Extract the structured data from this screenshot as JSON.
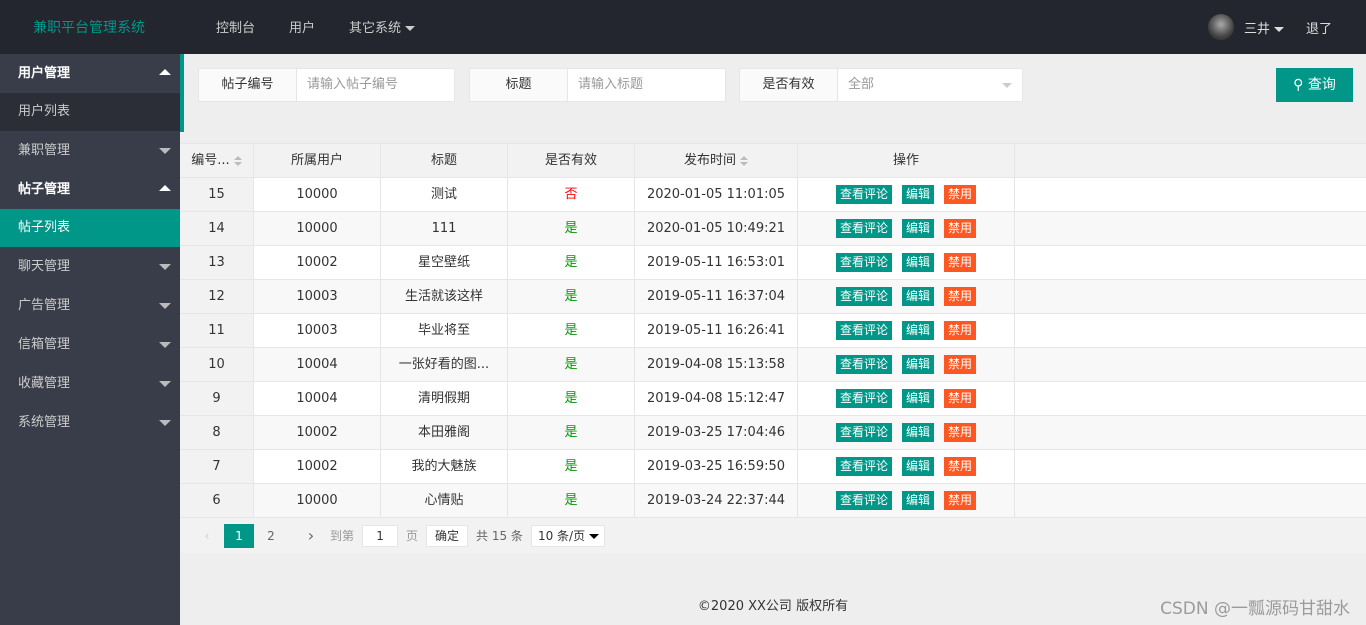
{
  "header": {
    "logo": "兼职平台管理系统",
    "nav": [
      "控制台",
      "用户",
      "其它系统"
    ],
    "user": "三井",
    "logout": "退了"
  },
  "sidebar": [
    {
      "label": "用户管理",
      "open": true,
      "children": [
        "用户列表"
      ]
    },
    {
      "label": "兼职管理",
      "open": false
    },
    {
      "label": "帖子管理",
      "open": true,
      "children": [
        "帖子列表"
      ]
    },
    {
      "label": "聊天管理",
      "open": false
    },
    {
      "label": "广告管理",
      "open": false
    },
    {
      "label": "信箱管理",
      "open": false
    },
    {
      "label": "收藏管理",
      "open": false
    },
    {
      "label": "系统管理",
      "open": false
    }
  ],
  "search": {
    "fields": [
      {
        "label": "帖子编号",
        "placeholder": "请输入帖子编号"
      },
      {
        "label": "标题",
        "placeholder": "请输入标题"
      },
      {
        "label": "是否有效",
        "value": "全部"
      }
    ],
    "button": "查询"
  },
  "table": {
    "headers": [
      "编号...",
      "所属用户",
      "标题",
      "是否有效",
      "发布时间",
      "操作"
    ],
    "actions": [
      "查看评论",
      "编辑",
      "禁用"
    ],
    "rows": [
      [
        "15",
        "10000",
        "测试",
        "否",
        "2020-01-05 11:01:05"
      ],
      [
        "14",
        "10000",
        "111",
        "是",
        "2020-01-05 10:49:21"
      ],
      [
        "13",
        "10002",
        "星空壁纸",
        "是",
        "2019-05-11 16:53:01"
      ],
      [
        "12",
        "10003",
        "生活就该这样",
        "是",
        "2019-05-11 16:37:04"
      ],
      [
        "11",
        "10003",
        "毕业将至",
        "是",
        "2019-05-11 16:26:41"
      ],
      [
        "10",
        "10004",
        "一张好看的图...",
        "是",
        "2019-04-08 15:13:58"
      ],
      [
        "9",
        "10004",
        "清明假期",
        "是",
        "2019-04-08 15:12:47"
      ],
      [
        "8",
        "10002",
        "本田雅阁",
        "是",
        "2019-03-25 17:04:46"
      ],
      [
        "7",
        "10002",
        "我的大魅族",
        "是",
        "2019-03-25 16:59:50"
      ],
      [
        "6",
        "10000",
        "心情贴",
        "是",
        "2019-03-24 22:37:44"
      ]
    ]
  },
  "pager": {
    "pages": [
      "1",
      "2"
    ],
    "current": "1",
    "goto": "到第",
    "goto_value": "1",
    "page_unit": "页",
    "confirm": "确定",
    "total": "共 15 条",
    "per_page": "10 条/页"
  },
  "footer": "©2020 XX公司 版权所有",
  "watermark": "CSDN @一瓢源码甘甜水",
  "colors": {
    "accent": "#009688",
    "danger": "#ff5722",
    "header": "#23262e",
    "sidebar": "#393d49"
  }
}
